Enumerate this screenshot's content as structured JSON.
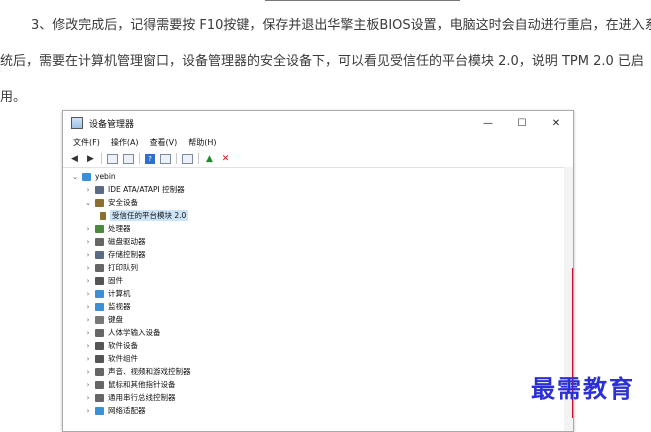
{
  "article": {
    "line1": "3、修改完成后，记得需要按 F10按键，保存并退出华擎主板BIOS设置，电脑这时会自动进行重启，在进入系",
    "line2": "统后，需要在计算机管理窗口，设备管理器的安全设备下，可以看见受信任的平台模块 2.0，说明 TPM 2.0 已启",
    "line3": "用。"
  },
  "window": {
    "title": "设备管理器",
    "controls": {
      "minimize": "—",
      "maximize": "☐",
      "close": "✕"
    },
    "menu": [
      "文件(F)",
      "操作(A)",
      "查看(V)",
      "帮助(H)"
    ]
  },
  "tree": {
    "root": "yebin",
    "items": [
      {
        "label": "IDE ATA/ATAPI 控制器",
        "icon_color": "#5a6b82"
      },
      {
        "label": "安全设备",
        "icon_color": "#8a6d2f",
        "expanded": true
      },
      {
        "label": "处理器",
        "icon_color": "#4a8a3a"
      },
      {
        "label": "磁盘驱动器",
        "icon_color": "#666666"
      },
      {
        "label": "存储控制器",
        "icon_color": "#5a6b82"
      },
      {
        "label": "打印队列",
        "icon_color": "#666666"
      },
      {
        "label": "固件",
        "icon_color": "#555555"
      },
      {
        "label": "计算机",
        "icon_color": "#3b8fd6"
      },
      {
        "label": "监视器",
        "icon_color": "#3b8fd6"
      },
      {
        "label": "键盘",
        "icon_color": "#777777"
      },
      {
        "label": "人体学输入设备",
        "icon_color": "#666666"
      },
      {
        "label": "软件设备",
        "icon_color": "#555555"
      },
      {
        "label": "软件组件",
        "icon_color": "#555555"
      },
      {
        "label": "声音、视频和游戏控制器",
        "icon_color": "#666666"
      },
      {
        "label": "鼠标和其他指针设备",
        "icon_color": "#666666"
      },
      {
        "label": "通用串行总线控制器",
        "icon_color": "#666666"
      },
      {
        "label": "网络适配器",
        "icon_color": "#3b8fd6"
      }
    ],
    "security_child": "受信任的平台模块 2.0"
  },
  "watermark": "最需教育"
}
